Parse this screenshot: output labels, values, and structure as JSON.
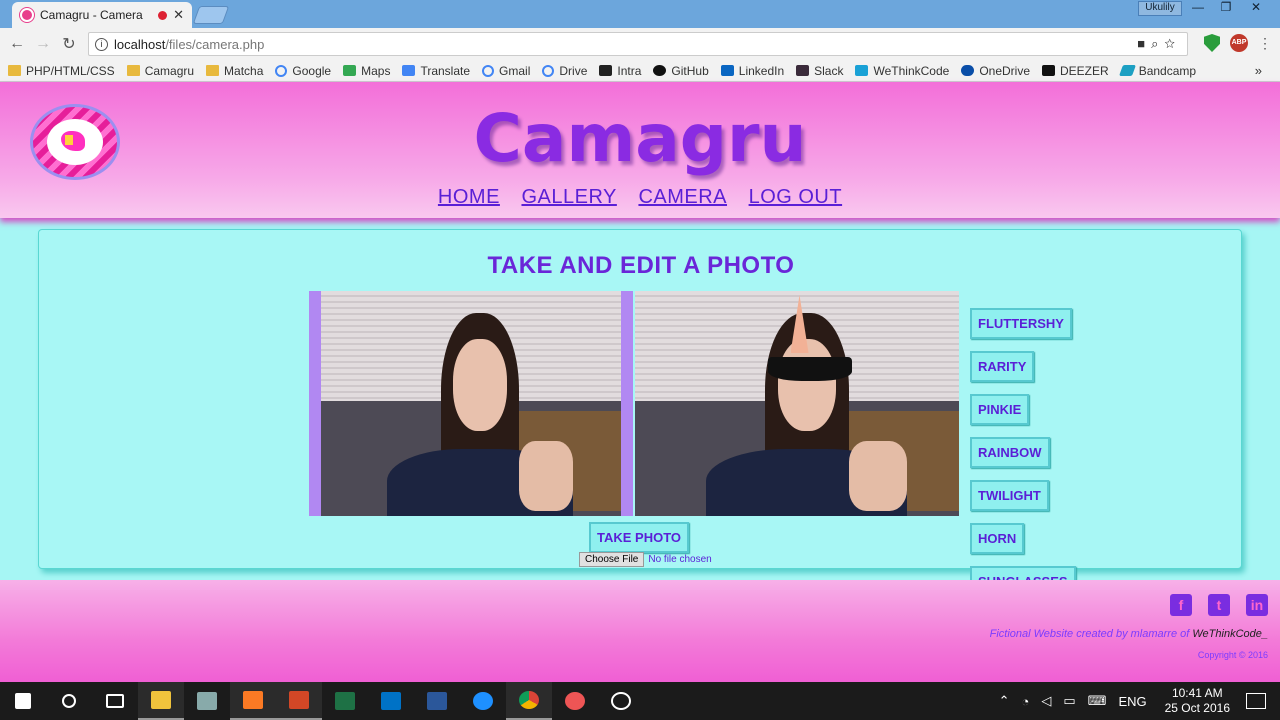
{
  "browser": {
    "tab_title": "Camagru - Camera",
    "tab_close": "✕",
    "user": "Ukulily",
    "window_buttons": [
      "—",
      "❐",
      "✕"
    ],
    "url_host": "localhost",
    "url_path": "/files/camera.php",
    "bookmarks": [
      {
        "label": "PHP/HTML/CSS",
        "icon": "folder-icon"
      },
      {
        "label": "Camagru",
        "icon": "folder-icon"
      },
      {
        "label": "Matcha",
        "icon": "folder-icon"
      },
      {
        "label": "Google",
        "icon": "google-icon"
      },
      {
        "label": "Maps",
        "icon": "maps-icon"
      },
      {
        "label": "Translate",
        "icon": "translate-icon"
      },
      {
        "label": "Gmail",
        "icon": "google-icon"
      },
      {
        "label": "Drive",
        "icon": "google-icon"
      },
      {
        "label": "Intra",
        "icon": "intra-icon"
      },
      {
        "label": "GitHub",
        "icon": "github-icon"
      },
      {
        "label": "LinkedIn",
        "icon": "linkedin-icon"
      },
      {
        "label": "Slack",
        "icon": "slack-icon"
      },
      {
        "label": "WeThinkCode",
        "icon": "wethinkcode-icon"
      },
      {
        "label": "OneDrive",
        "icon": "onedrive-icon"
      },
      {
        "label": "DEEZER",
        "icon": "deezer-icon"
      },
      {
        "label": "Bandcamp",
        "icon": "bandcamp-icon"
      }
    ],
    "more": "»",
    "ext_abp": "ABP"
  },
  "site": {
    "title": "Camagru",
    "nav": [
      "HOME",
      "GALLERY",
      "CAMERA",
      "LOG OUT"
    ],
    "card_title": "TAKE AND EDIT A PHOTO",
    "overlays": [
      "FLUTTERSHY",
      "RARITY",
      "PINKIE",
      "RAINBOW",
      "TWILIGHT",
      "HORN",
      "SUNGLASSES"
    ],
    "take_photo": "TAKE PHOTO",
    "choose_file": "Choose File",
    "no_file": "No file chosen",
    "footer_credit": "Fictional Website created by mlamarre of",
    "footer_brand": "WeThinkCode_",
    "copyright": "Copyright © 2016",
    "socials": [
      "f",
      "t",
      "in"
    ]
  },
  "taskbar": {
    "lang": "ENG",
    "time": "10:41 AM",
    "date": "25 Oct 2016"
  }
}
